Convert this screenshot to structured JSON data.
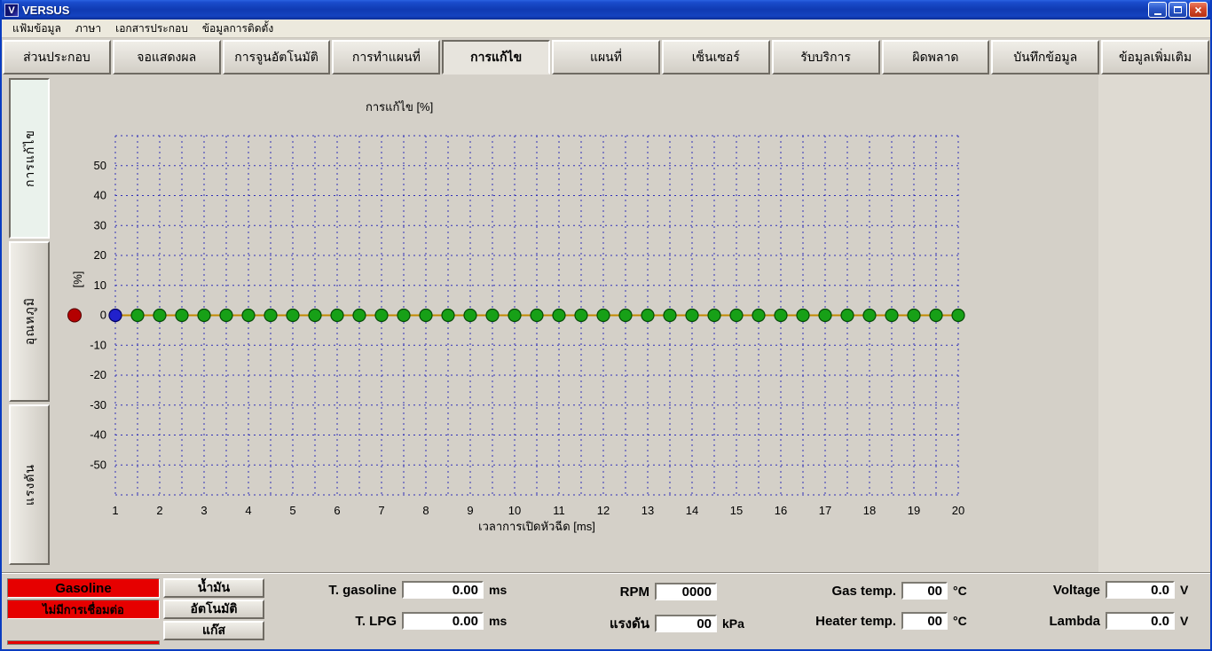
{
  "window": {
    "title": "VERSUS"
  },
  "menu_bar": {
    "items": [
      "แฟ้มข้อมูล",
      "ภาษา",
      "เอกสารประกอบ",
      "ข้อมูลการติดตั้ง"
    ]
  },
  "tab_bar": {
    "active_index": 4,
    "tabs": [
      "ส่วนประกอบ",
      "จอแสดงผล",
      "การจูนอัตโนมัติ",
      "การทำแผนที่",
      "การแก้ไข",
      "แผนที่",
      "เซ็นเซอร์",
      "รับบริการ",
      "ผิดพลาด",
      "บันทึกข้อมูล",
      "ข้อมูลเพิ่มเติม"
    ]
  },
  "side_tab_bar": {
    "active_index": 0,
    "tabs": [
      "การแก้ไข",
      "อุณหภูมิ",
      "แรงดัน"
    ]
  },
  "chart_data": {
    "type": "line",
    "title": "การแก้ไข [%]",
    "xlabel": "เวลาการเปิดหัวฉีด [ms]",
    "ylabel": "[%]",
    "xlim": [
      1,
      20
    ],
    "ylim": [
      -60,
      60
    ],
    "x_grid_step": 0.5,
    "y_grid_step": 10,
    "xticks": [
      1,
      2,
      3,
      4,
      5,
      6,
      7,
      8,
      9,
      10,
      11,
      12,
      13,
      14,
      15,
      16,
      17,
      18,
      19,
      20
    ],
    "yticks": [
      50,
      40,
      30,
      20,
      10,
      0,
      -10,
      -20,
      -30,
      -40,
      -50
    ],
    "x": [
      1,
      1.5,
      2,
      2.5,
      3,
      3.5,
      4,
      4.5,
      5,
      5.5,
      6,
      6.5,
      7,
      7.5,
      8,
      8.5,
      9,
      9.5,
      10,
      10.5,
      11,
      11.5,
      12,
      12.5,
      13,
      13.5,
      14,
      14.5,
      15,
      15.5,
      16,
      16.5,
      17,
      17.5,
      18,
      18.5,
      19,
      19.5,
      20
    ],
    "y": [
      0,
      0,
      0,
      0,
      0,
      0,
      0,
      0,
      0,
      0,
      0,
      0,
      0,
      0,
      0,
      0,
      0,
      0,
      0,
      0,
      0,
      0,
      0,
      0,
      0,
      0,
      0,
      0,
      0,
      0,
      0,
      0,
      0,
      0,
      0,
      0,
      0,
      0,
      0
    ],
    "selected_point": {
      "x": 1,
      "y": 0,
      "color": "#2121cc"
    },
    "offscale_marker": {
      "y": 0,
      "color": "#b40000"
    },
    "style": {
      "grid": true,
      "legend": false,
      "grid_color": "#3030b8",
      "line_color": "#c28a00",
      "point_color": "#17a017",
      "point_stroke": "#064a06",
      "background": "#d4d0c8"
    }
  },
  "status_panel": {
    "fuel_mode": {
      "label": "Gasoline",
      "color": "#e60000"
    },
    "connection": {
      "label": "ไม่มีการเชื่อมต่อ",
      "color": "#e60000"
    },
    "buttons": [
      "น้ำมัน",
      "อัตโนมัติ",
      "แก๊ส"
    ],
    "readouts": {
      "t_gasoline": {
        "label": "T. gasoline",
        "value": "0.00",
        "unit": "ms"
      },
      "t_lpg": {
        "label": "T. LPG",
        "value": "0.00",
        "unit": "ms"
      },
      "rpm": {
        "label": "RPM",
        "value": "0000",
        "unit": ""
      },
      "pressure": {
        "label": "แรงดัน",
        "value": "00",
        "unit": "kPa"
      },
      "gas_temp": {
        "label": "Gas temp.",
        "value": "00",
        "unit": "°C"
      },
      "heater_temp": {
        "label": "Heater temp.",
        "value": "00",
        "unit": "°C"
      },
      "voltage": {
        "label": "Voltage",
        "value": "0.0",
        "unit": "V"
      },
      "lambda": {
        "label": "Lambda",
        "value": "0.0",
        "unit": "V"
      }
    }
  }
}
